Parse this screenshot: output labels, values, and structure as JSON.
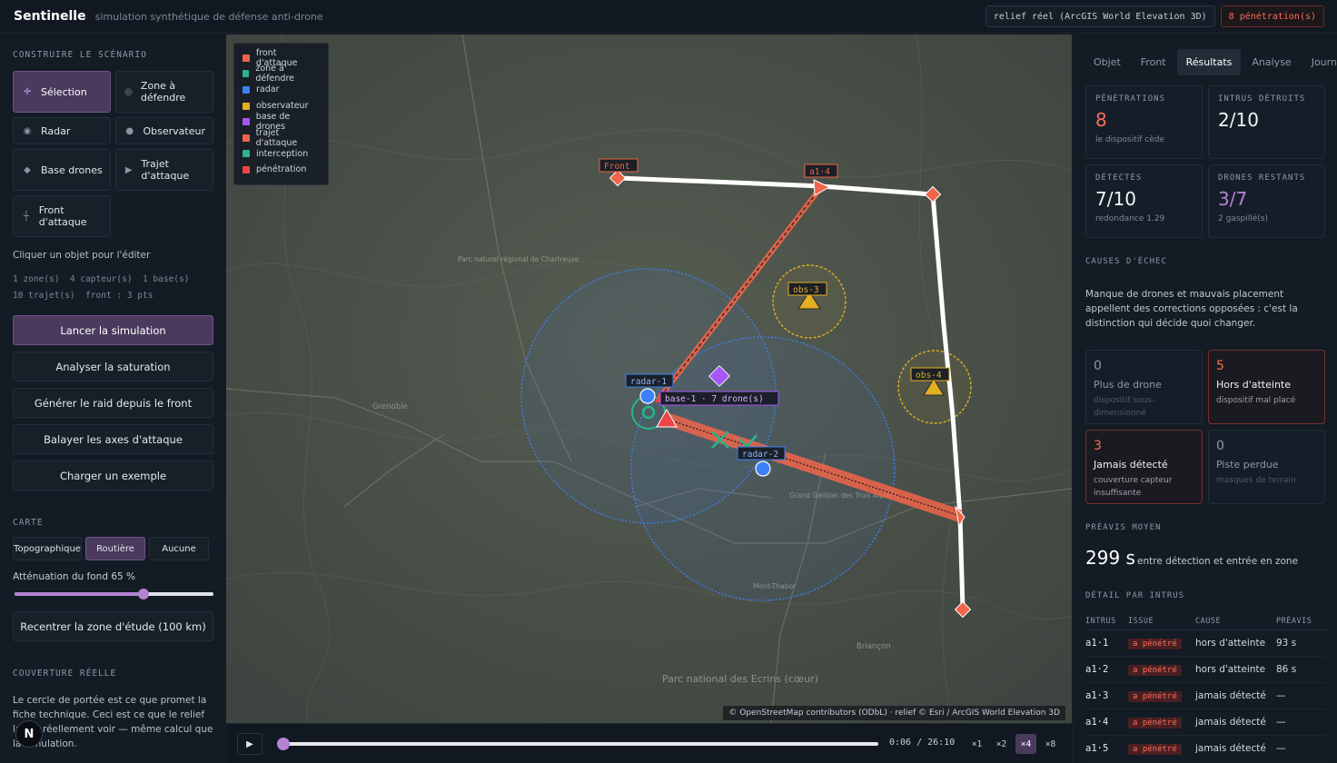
{
  "header": {
    "brand": "Sentinelle",
    "subtitle": "simulation synthétique de défense anti-drone",
    "relief_label": "relief réel (ArcGIS World Elevation 3D)",
    "alert_label": "8 pénétration(s)"
  },
  "left": {
    "section_build": "CONSTRUIRE LE SCÉNARIO",
    "tools": [
      {
        "label": "Sélection",
        "icon": "crosshair-icon"
      },
      {
        "label": "Zone à défendre",
        "icon": "target-icon"
      },
      {
        "label": "Radar",
        "icon": "radar-dot-icon"
      },
      {
        "label": "Observateur",
        "icon": "observer-dot-icon"
      },
      {
        "label": "Base drones",
        "icon": "diamond-icon"
      },
      {
        "label": "Trajet d'attaque",
        "icon": "play-arrow-icon"
      },
      {
        "label": "Front d'attaque",
        "icon": "plus-icon"
      }
    ],
    "hint": "Cliquer un objet pour l'éditer",
    "counts_line1": "1 zone(s)  4 capteur(s)  1 base(s)",
    "counts_line2": "10 trajet(s)  front : 3 pts",
    "buttons": {
      "run": "Lancer la simulation",
      "saturation": "Analyser la saturation",
      "raid": "Générer le raid depuis le front",
      "sweep": "Balayer les axes d'attaque",
      "example": "Charger un exemple"
    },
    "section_map": "CARTE",
    "map_modes": [
      "Topographique",
      "Routière",
      "Aucune"
    ],
    "map_mode_selected": "Routière",
    "attenuation_label": "Atténuation du fond 65  %",
    "attenuation_value": 0.65,
    "recenter": "Recentrer la zone d'étude (100 km)",
    "section_coverage": "COUVERTURE RÉELLE",
    "coverage_text": "Le cercle de portée est ce que promet la fiche technique. Ceci est ce que le relief laisse réellement voir — même calcul que la simulation.",
    "badge": "N"
  },
  "map": {
    "legend": [
      {
        "label": "front d'attaque",
        "color": "#f0654a"
      },
      {
        "label": "zone à défendre",
        "color": "#2ab38c"
      },
      {
        "label": "radar",
        "color": "#3b82f6"
      },
      {
        "label": "observateur",
        "color": "#e2b021"
      },
      {
        "label": "base de drones",
        "color": "#a855f7"
      },
      {
        "label": "trajet d'attaque",
        "color": "#f0654a"
      },
      {
        "label": "interception",
        "color": "#2ab38c"
      },
      {
        "label": "pénétration",
        "color": "#ef4444"
      }
    ],
    "place_labels": [
      "Grenoble",
      "Parc naturel régional de Chartreuse",
      "Briançon",
      "Parc national des Ecrins (cœur)",
      "Mont-Thabor",
      "Grand Galibier des Trois Alpes"
    ],
    "object_labels": {
      "front": "Front",
      "a14": "a1·4",
      "obs3": "obs-3",
      "obs4": "obs-4",
      "radar1": "radar-1",
      "radar2": "radar-2",
      "base1": "base-1 · 7 drone(s)"
    },
    "attribution": "© OpenStreetMap contributors (ODbL) · relief © Esri / ArcGIS World Elevation 3D"
  },
  "timeline": {
    "time": "0:06 / 26:10",
    "progress": 0.004,
    "speeds": [
      "×1",
      "×2",
      "×4",
      "×8"
    ],
    "speed_selected": "×4"
  },
  "right": {
    "tabs": [
      "Objet",
      "Front",
      "Résultats",
      "Analyse",
      "Journal"
    ],
    "tab_selected": "Résultats",
    "kpis": [
      {
        "label": "PÉNÉTRATIONS",
        "value": "8",
        "sub": "le dispositif cède",
        "color": "#ff6b5a"
      },
      {
        "label": "INTRUS DÉTRUITS",
        "value": "2/10",
        "sub": "",
        "color": "#f2f4f6"
      },
      {
        "label": "DÉTECTÉS",
        "value": "7/10",
        "sub": "redondance 1.29",
        "color": "#f2f4f6"
      },
      {
        "label": "DRONES RESTANTS",
        "value": "3/7",
        "sub": "2 gaspillé(s)",
        "color": "#b483d4"
      }
    ],
    "causes_title": "CAUSES D'ÉCHEC",
    "causes_text": "Manque de drones et mauvais placement appellent des corrections opposées : c'est la distinction qui décide quoi changer.",
    "causes": [
      {
        "count": "0",
        "title": "Plus de drone",
        "desc": "dispositif sous-dimensionné"
      },
      {
        "count": "5",
        "title": "Hors d'atteinte",
        "desc": "dispositif mal placé"
      },
      {
        "count": "3",
        "title": "Jamais détecté",
        "desc": "couverture capteur insuffisante"
      },
      {
        "count": "0",
        "title": "Piste perdue",
        "desc": "masques de terrain"
      }
    ],
    "avg_title": "PRÉAVIS MOYEN",
    "avg_value": "299 s",
    "avg_sub": "entre détection et entrée en zone",
    "detail_title": "DÉTAIL PAR INTRUS",
    "table_headers": [
      "INTRUS",
      "ISSUE",
      "CAUSE",
      "PRÉAVIS"
    ],
    "rows": [
      [
        "a1·1",
        "a pénétré",
        "hors d'atteinte",
        "93 s"
      ],
      [
        "a1·2",
        "a pénétré",
        "hors d'atteinte",
        "86 s"
      ],
      [
        "a1·3",
        "a pénétré",
        "jamais détecté",
        "—"
      ],
      [
        "a1·4",
        "a pénétré",
        "jamais détecté",
        "—"
      ],
      [
        "a1·5",
        "a pénétré",
        "jamais détecté",
        "—"
      ]
    ]
  }
}
